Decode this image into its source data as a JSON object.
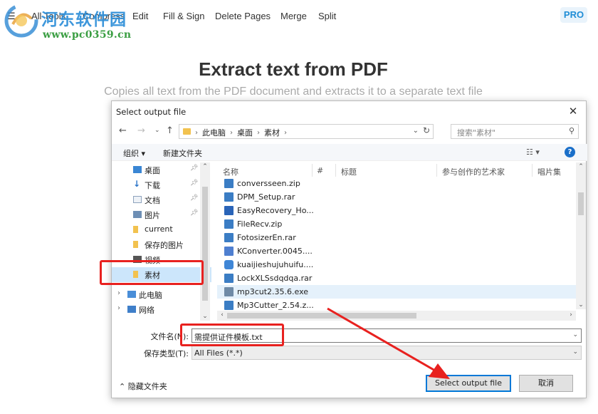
{
  "topnav": {
    "items": [
      {
        "label": "All Tools"
      },
      {
        "label": "Compress"
      },
      {
        "label": "Edit"
      },
      {
        "label": "Fill & Sign"
      },
      {
        "label": "Delete Pages"
      },
      {
        "label": "Merge"
      },
      {
        "label": "Split"
      }
    ],
    "pro_label": "PRO"
  },
  "watermark": {
    "title": "河东软件园",
    "url": "www.pc0359.cn"
  },
  "hero": {
    "title": "Extract text from PDF",
    "subtitle": "Copies all text from the PDF document and extracts it to a separate text file"
  },
  "dialog": {
    "title": "Select output file",
    "close_symbol": "✕",
    "breadcrumbs": [
      "此电脑",
      "桌面",
      "素材"
    ],
    "search_placeholder": "搜索\"素材\"",
    "toolbar": {
      "organize": "组织 ▾",
      "new_folder": "新建文件夹"
    },
    "nav_items": [
      {
        "label": "桌面",
        "icon": "desktop-icon",
        "pinned": true
      },
      {
        "label": "下载",
        "icon": "download-icon",
        "pinned": true
      },
      {
        "label": "文档",
        "icon": "document-icon",
        "pinned": true
      },
      {
        "label": "图片",
        "icon": "picture-icon",
        "pinned": true
      },
      {
        "label": "current",
        "icon": "folder-icon",
        "pinned": false
      },
      {
        "label": "保存的图片",
        "icon": "folder-icon",
        "pinned": false
      },
      {
        "label": "视频",
        "icon": "video-icon",
        "pinned": false
      },
      {
        "label": "素材",
        "icon": "folder-icon",
        "pinned": false,
        "selected": true
      },
      {
        "label": "此电脑",
        "icon": "computer-icon",
        "pinned": false
      },
      {
        "label": "网络",
        "icon": "network-icon",
        "pinned": false
      }
    ],
    "columns": [
      "名称",
      "#",
      "标题",
      "参与创作的艺术家",
      "唱片集"
    ],
    "files": [
      {
        "name": "conversseen.zip",
        "icon": "archive-icon",
        "color": "#3b7dc4"
      },
      {
        "name": "DPM_Setup.rar",
        "icon": "archive-icon",
        "color": "#3b7dc4"
      },
      {
        "name": "EasyRecovery_Ho...",
        "icon": "app-icon",
        "color": "#2a64b8"
      },
      {
        "name": "FileRecv.zip",
        "icon": "archive-icon",
        "color": "#3b7dc4"
      },
      {
        "name": "FotosizerEn.rar",
        "icon": "archive-icon",
        "color": "#3b7dc4"
      },
      {
        "name": "KConverter.0045....",
        "icon": "app-icon",
        "color": "#4f7fd0"
      },
      {
        "name": "kuaijieshujuhuifu....",
        "icon": "app-icon",
        "color": "#3f86d6"
      },
      {
        "name": "LockXLSsdqdqa.rar",
        "icon": "archive-icon",
        "color": "#3b7dc4"
      },
      {
        "name": "mp3cut2.35.6.exe",
        "icon": "installer-icon",
        "color": "#6f8aa6",
        "hover": true
      },
      {
        "name": "Mp3Cutter_2.54.z...",
        "icon": "archive-icon",
        "color": "#3b7dc4"
      }
    ],
    "filename_label": "文件名(N):",
    "filename_value": "需提供证件模板.txt",
    "filetype_label": "保存类型(T):",
    "filetype_value": "All Files (*.*)",
    "hide_folders": "隐藏文件夹",
    "confirm_button": "Select output file",
    "cancel_button": "取消"
  }
}
